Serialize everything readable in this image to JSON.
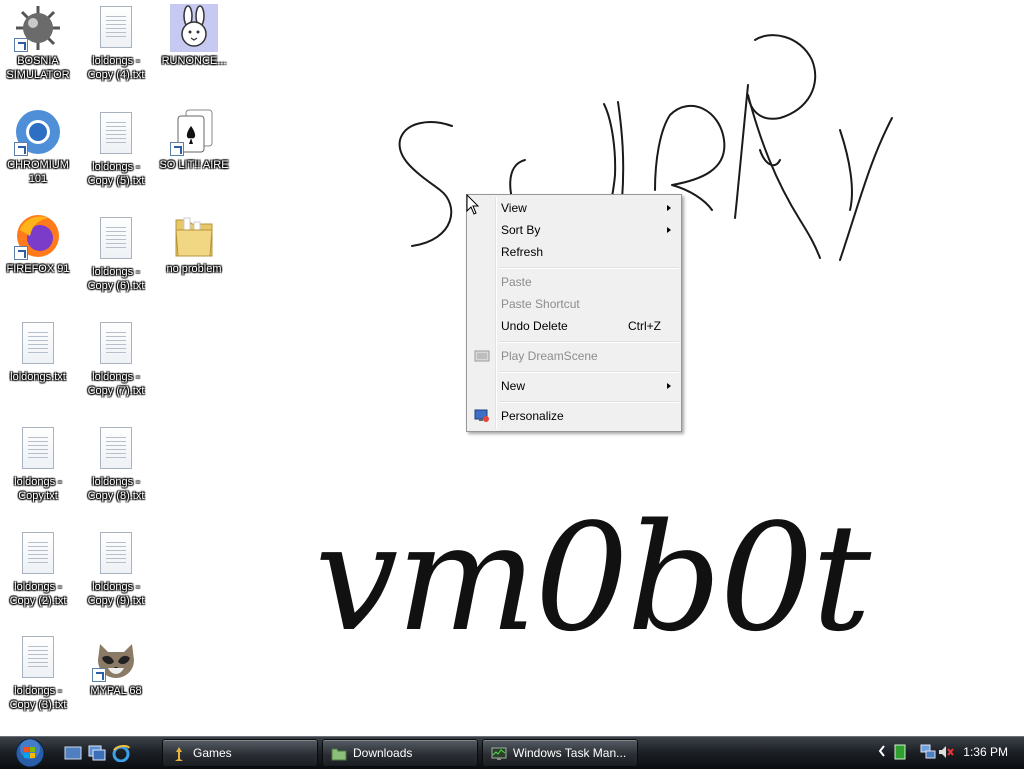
{
  "wallpaper": {
    "logo_text": "vm0b0t"
  },
  "desktop_icons": [
    {
      "id": "bosnia",
      "label": "BOSNIA SIMULATOR",
      "icon": "mine-icon",
      "shortcut": true
    },
    {
      "id": "chromium",
      "label": "CHROMIUM 101",
      "icon": "chromium-icon",
      "shortcut": true
    },
    {
      "id": "firefox",
      "label": "FIREFOX 91",
      "icon": "firefox-icon",
      "shortcut": true
    },
    {
      "id": "loldongs",
      "label": "loldongs.txt",
      "icon": "text-file-icon",
      "shortcut": false
    },
    {
      "id": "loldongs-copy",
      "label": "loldongs - Copy.txt",
      "icon": "text-file-icon",
      "shortcut": false
    },
    {
      "id": "loldongs-copy2",
      "label": "loldongs - Copy (2).txt",
      "icon": "text-file-icon",
      "shortcut": false
    },
    {
      "id": "loldongs-copy3",
      "label": "loldongs - Copy (3).txt",
      "icon": "text-file-icon",
      "shortcut": false
    },
    {
      "id": "loldongs-copy4",
      "label": "loldongs - Copy (4).txt",
      "icon": "text-file-icon",
      "shortcut": false
    },
    {
      "id": "loldongs-copy5",
      "label": "loldongs - Copy (5).txt",
      "icon": "text-file-icon",
      "shortcut": false
    },
    {
      "id": "loldongs-copy6",
      "label": "loldongs - Copy (6).txt",
      "icon": "text-file-icon",
      "shortcut": false
    },
    {
      "id": "loldongs-copy7",
      "label": "loldongs - Copy (7).txt",
      "icon": "text-file-icon",
      "shortcut": false
    },
    {
      "id": "loldongs-copy8",
      "label": "loldongs - Copy (8).txt",
      "icon": "text-file-icon",
      "shortcut": false
    },
    {
      "id": "loldongs-copy9",
      "label": "loldongs - Copy (9).txt",
      "icon": "text-file-icon",
      "shortcut": false
    },
    {
      "id": "mypal",
      "label": "MYPAL 68",
      "icon": "raccoon-icon",
      "shortcut": true
    },
    {
      "id": "runonce",
      "label": "RUNONCE...",
      "icon": "bunny-icon",
      "shortcut": false
    },
    {
      "id": "solitaire",
      "label": "SO LIT!! AIRE",
      "icon": "cards-icon",
      "shortcut": true
    },
    {
      "id": "noproblem",
      "label": "no problem",
      "icon": "folder-icon",
      "shortcut": false
    }
  ],
  "context_menu": {
    "items": [
      {
        "label": "View",
        "submenu": true,
        "disabled": false
      },
      {
        "label": "Sort By",
        "submenu": true,
        "disabled": false
      },
      {
        "label": "Refresh",
        "submenu": false,
        "disabled": false
      },
      {
        "label": "Paste",
        "submenu": false,
        "disabled": true
      },
      {
        "label": "Paste Shortcut",
        "submenu": false,
        "disabled": true
      },
      {
        "label": "Undo Delete",
        "shortcut": "Ctrl+Z",
        "submenu": false,
        "disabled": false
      },
      {
        "label": "Play DreamScene",
        "submenu": false,
        "disabled": true,
        "icon": "dreamscene-icon"
      },
      {
        "label": "New",
        "submenu": true,
        "disabled": false
      },
      {
        "label": "Personalize",
        "submenu": false,
        "disabled": false,
        "icon": "personalize-icon"
      }
    ]
  },
  "taskbar": {
    "buttons": [
      {
        "label": "Games",
        "icon": "games-icon"
      },
      {
        "label": "Downloads",
        "icon": "folder-icon"
      },
      {
        "label": "Windows Task Man...",
        "icon": "task-manager-icon"
      }
    ],
    "clock": "1:36 PM"
  }
}
